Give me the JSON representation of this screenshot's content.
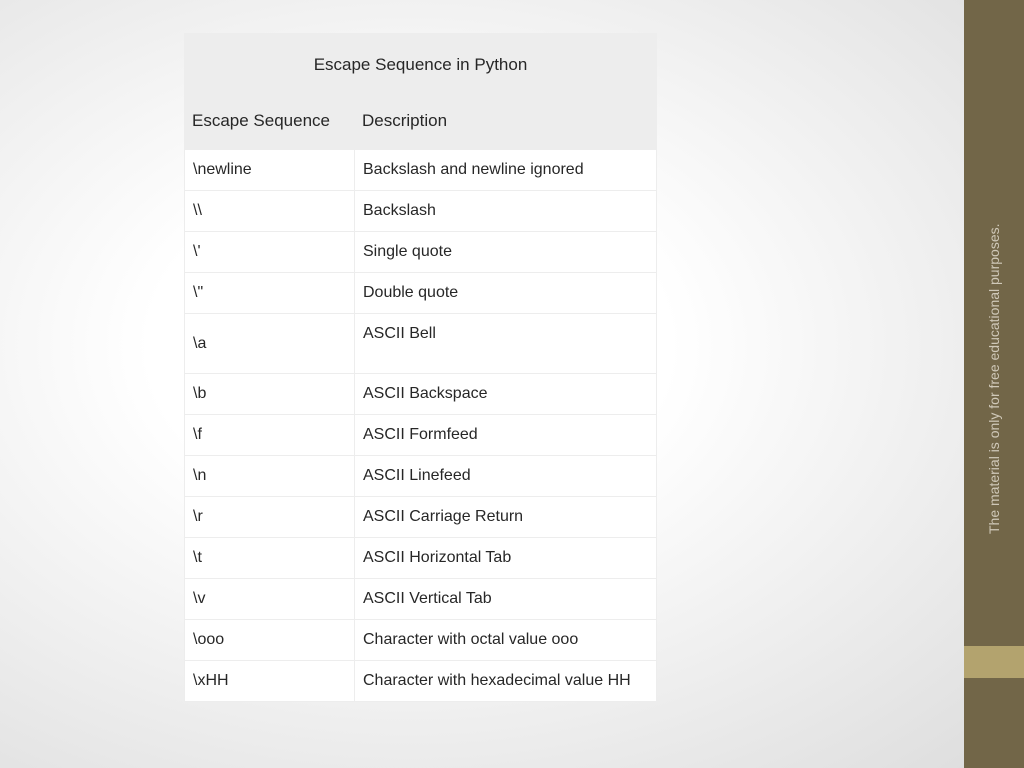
{
  "title": "Escape Sequence in Python",
  "headers": {
    "col1": "Escape Sequence",
    "col2": "Description"
  },
  "rows": [
    {
      "seq": "\\newline",
      "desc": "Backslash and newline ignored"
    },
    {
      "seq": "\\\\",
      "desc": "Backslash"
    },
    {
      "seq": "\\'",
      "desc": "Single quote"
    },
    {
      "seq": "\\\"",
      "desc": "Double quote"
    },
    {
      "seq": "\\a",
      "desc": "ASCII Bell"
    },
    {
      "seq": "\\b",
      "desc": "ASCII Backspace"
    },
    {
      "seq": "\\f",
      "desc": "ASCII Formfeed"
    },
    {
      "seq": "\\n",
      "desc": "ASCII Linefeed"
    },
    {
      "seq": "\\r",
      "desc": "ASCII Carriage Return"
    },
    {
      "seq": "\\t",
      "desc": "ASCII Horizontal Tab"
    },
    {
      "seq": "\\v",
      "desc": "ASCII Vertical Tab"
    },
    {
      "seq": "\\ooo",
      "desc": "Character with octal value ooo"
    },
    {
      "seq": "\\xHH",
      "desc": "Character with hexadecimal value HH"
    }
  ],
  "sidebar_text": "The material is only for free educational purposes."
}
